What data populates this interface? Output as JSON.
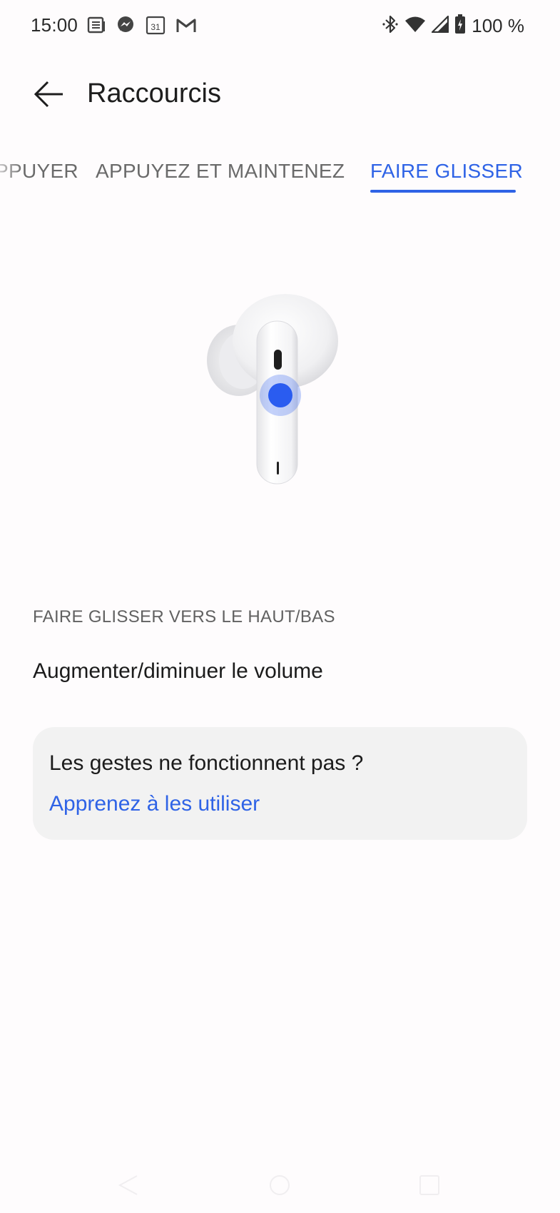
{
  "status_bar": {
    "time": "15:00",
    "battery_text": "100 %",
    "calendar_day": "31",
    "icons_left": [
      "news-icon",
      "messenger-icon",
      "calendar-icon",
      "gmail-icon"
    ],
    "icons_right": [
      "bluetooth-icon",
      "wifi-icon",
      "signal-icon",
      "battery-icon"
    ]
  },
  "app_bar": {
    "title": "Raccourcis"
  },
  "tabs": [
    {
      "label": "APPUYER",
      "visible_text": "PPUYER",
      "active": false
    },
    {
      "label": "APPUYEZ ET MAINTENEZ",
      "active": false
    },
    {
      "label": "FAIRE GLISSER",
      "active": true
    }
  ],
  "section": {
    "header": "FAIRE GLISSER VERS LE HAUT/BAS",
    "value": "Augmenter/diminuer le volume"
  },
  "help_card": {
    "question": "Les gestes ne fonctionnent pas ?",
    "link": "Apprenez à les utiliser"
  },
  "colors": {
    "accent": "#2f63e6",
    "background": "#fefcfd",
    "card_background": "#f2f2f2",
    "touch_dot": "#2a5cf0"
  }
}
